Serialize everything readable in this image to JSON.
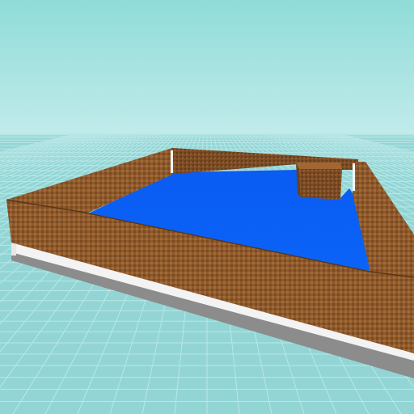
{
  "scene": {
    "kind": "3d-build-preview",
    "objects": [
      {
        "name": "baseplate",
        "color": "#8fd2d3",
        "grid": true
      },
      {
        "name": "water-pool",
        "color": "#0a5ff5"
      },
      {
        "name": "pool-wall",
        "material": "wood",
        "color": "#8b5a2b"
      },
      {
        "name": "base-slab",
        "color": "#f2f2f2"
      },
      {
        "name": "wood-block-corner",
        "material": "wood",
        "color": "#8b5a2b"
      }
    ]
  },
  "colors": {
    "sky_top": "#8fdcd8",
    "sky_bottom": "#c3ecec",
    "ground": "#93d5d5",
    "grid_line": "#b6e6e6",
    "water": "#0a5ff5",
    "wood_light": "#a36a35",
    "wood_dark": "#6e4522",
    "slab_white": "#f3f3f3",
    "slab_gray": "#8c8c8c"
  }
}
